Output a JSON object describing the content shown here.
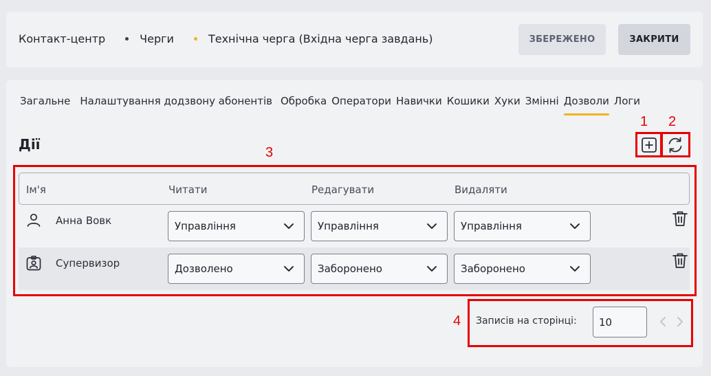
{
  "breadcrumb": {
    "items": [
      "Контакт-центр",
      "Черги",
      "Технічна черга (Вхідна черга завдань)"
    ]
  },
  "buttons": {
    "saved": "ЗБЕРЕЖЕНО",
    "close": "ЗАКРИТИ"
  },
  "tabs": [
    {
      "label": "Загальне"
    },
    {
      "label": "Налаштування додзвону абонентів"
    },
    {
      "label": "Обробка"
    },
    {
      "label": "Оператори"
    },
    {
      "label": "Навички"
    },
    {
      "label": "Кошики"
    },
    {
      "label": "Хуки"
    },
    {
      "label": "Змінні"
    },
    {
      "label": "Дозволи",
      "active": true
    },
    {
      "label": "Логи"
    }
  ],
  "section": {
    "title": "Дії"
  },
  "annotations": [
    "1",
    "2",
    "3",
    "4"
  ],
  "table": {
    "columns": [
      "Ім'я",
      "Читати",
      "Редагувати",
      "Видаляти"
    ],
    "rows": [
      {
        "icon": "user-icon",
        "name": "Анна Вовк",
        "read": "Управління",
        "edit": "Управління",
        "delete": "Управління"
      },
      {
        "icon": "badge-icon",
        "name": "Супервизор",
        "read": "Дозволено",
        "edit": "Заборонено",
        "delete": "Заборонено"
      }
    ]
  },
  "pagination": {
    "label": "Записів на сторінці:",
    "per_page": "10"
  },
  "colors": {
    "accent": "#f2b21c",
    "annotation": "#e60000"
  }
}
